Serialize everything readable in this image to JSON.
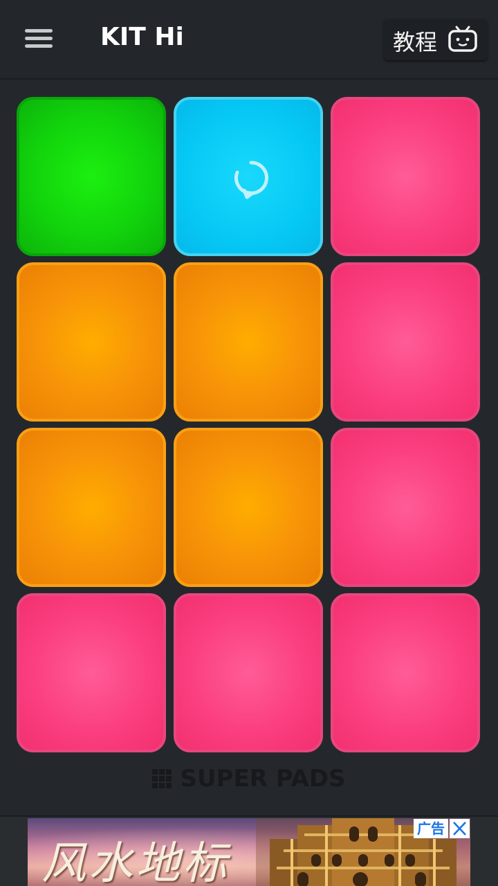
{
  "header": {
    "title": "KIT Hi",
    "tutorial_label": "教程"
  },
  "pads": [
    {
      "color": "green",
      "icon": null
    },
    {
      "color": "blue",
      "icon": "reload-icon"
    },
    {
      "color": "pink",
      "icon": null
    },
    {
      "color": "orange",
      "icon": null
    },
    {
      "color": "orange",
      "icon": null
    },
    {
      "color": "pink",
      "icon": null
    },
    {
      "color": "orange",
      "icon": null
    },
    {
      "color": "orange",
      "icon": null
    },
    {
      "color": "pink",
      "icon": null
    },
    {
      "color": "pink",
      "icon": null
    },
    {
      "color": "pink",
      "icon": null
    },
    {
      "color": "pink",
      "icon": null
    }
  ],
  "brand": {
    "text": "SUPER PADS"
  },
  "ad": {
    "label": "广告",
    "calligraphy": "风水地标"
  },
  "colors": {
    "background": "#24282c",
    "green": "#12d40c",
    "blue": "#06c9f5",
    "orange": "#f79408",
    "pink": "#fb3f80"
  }
}
